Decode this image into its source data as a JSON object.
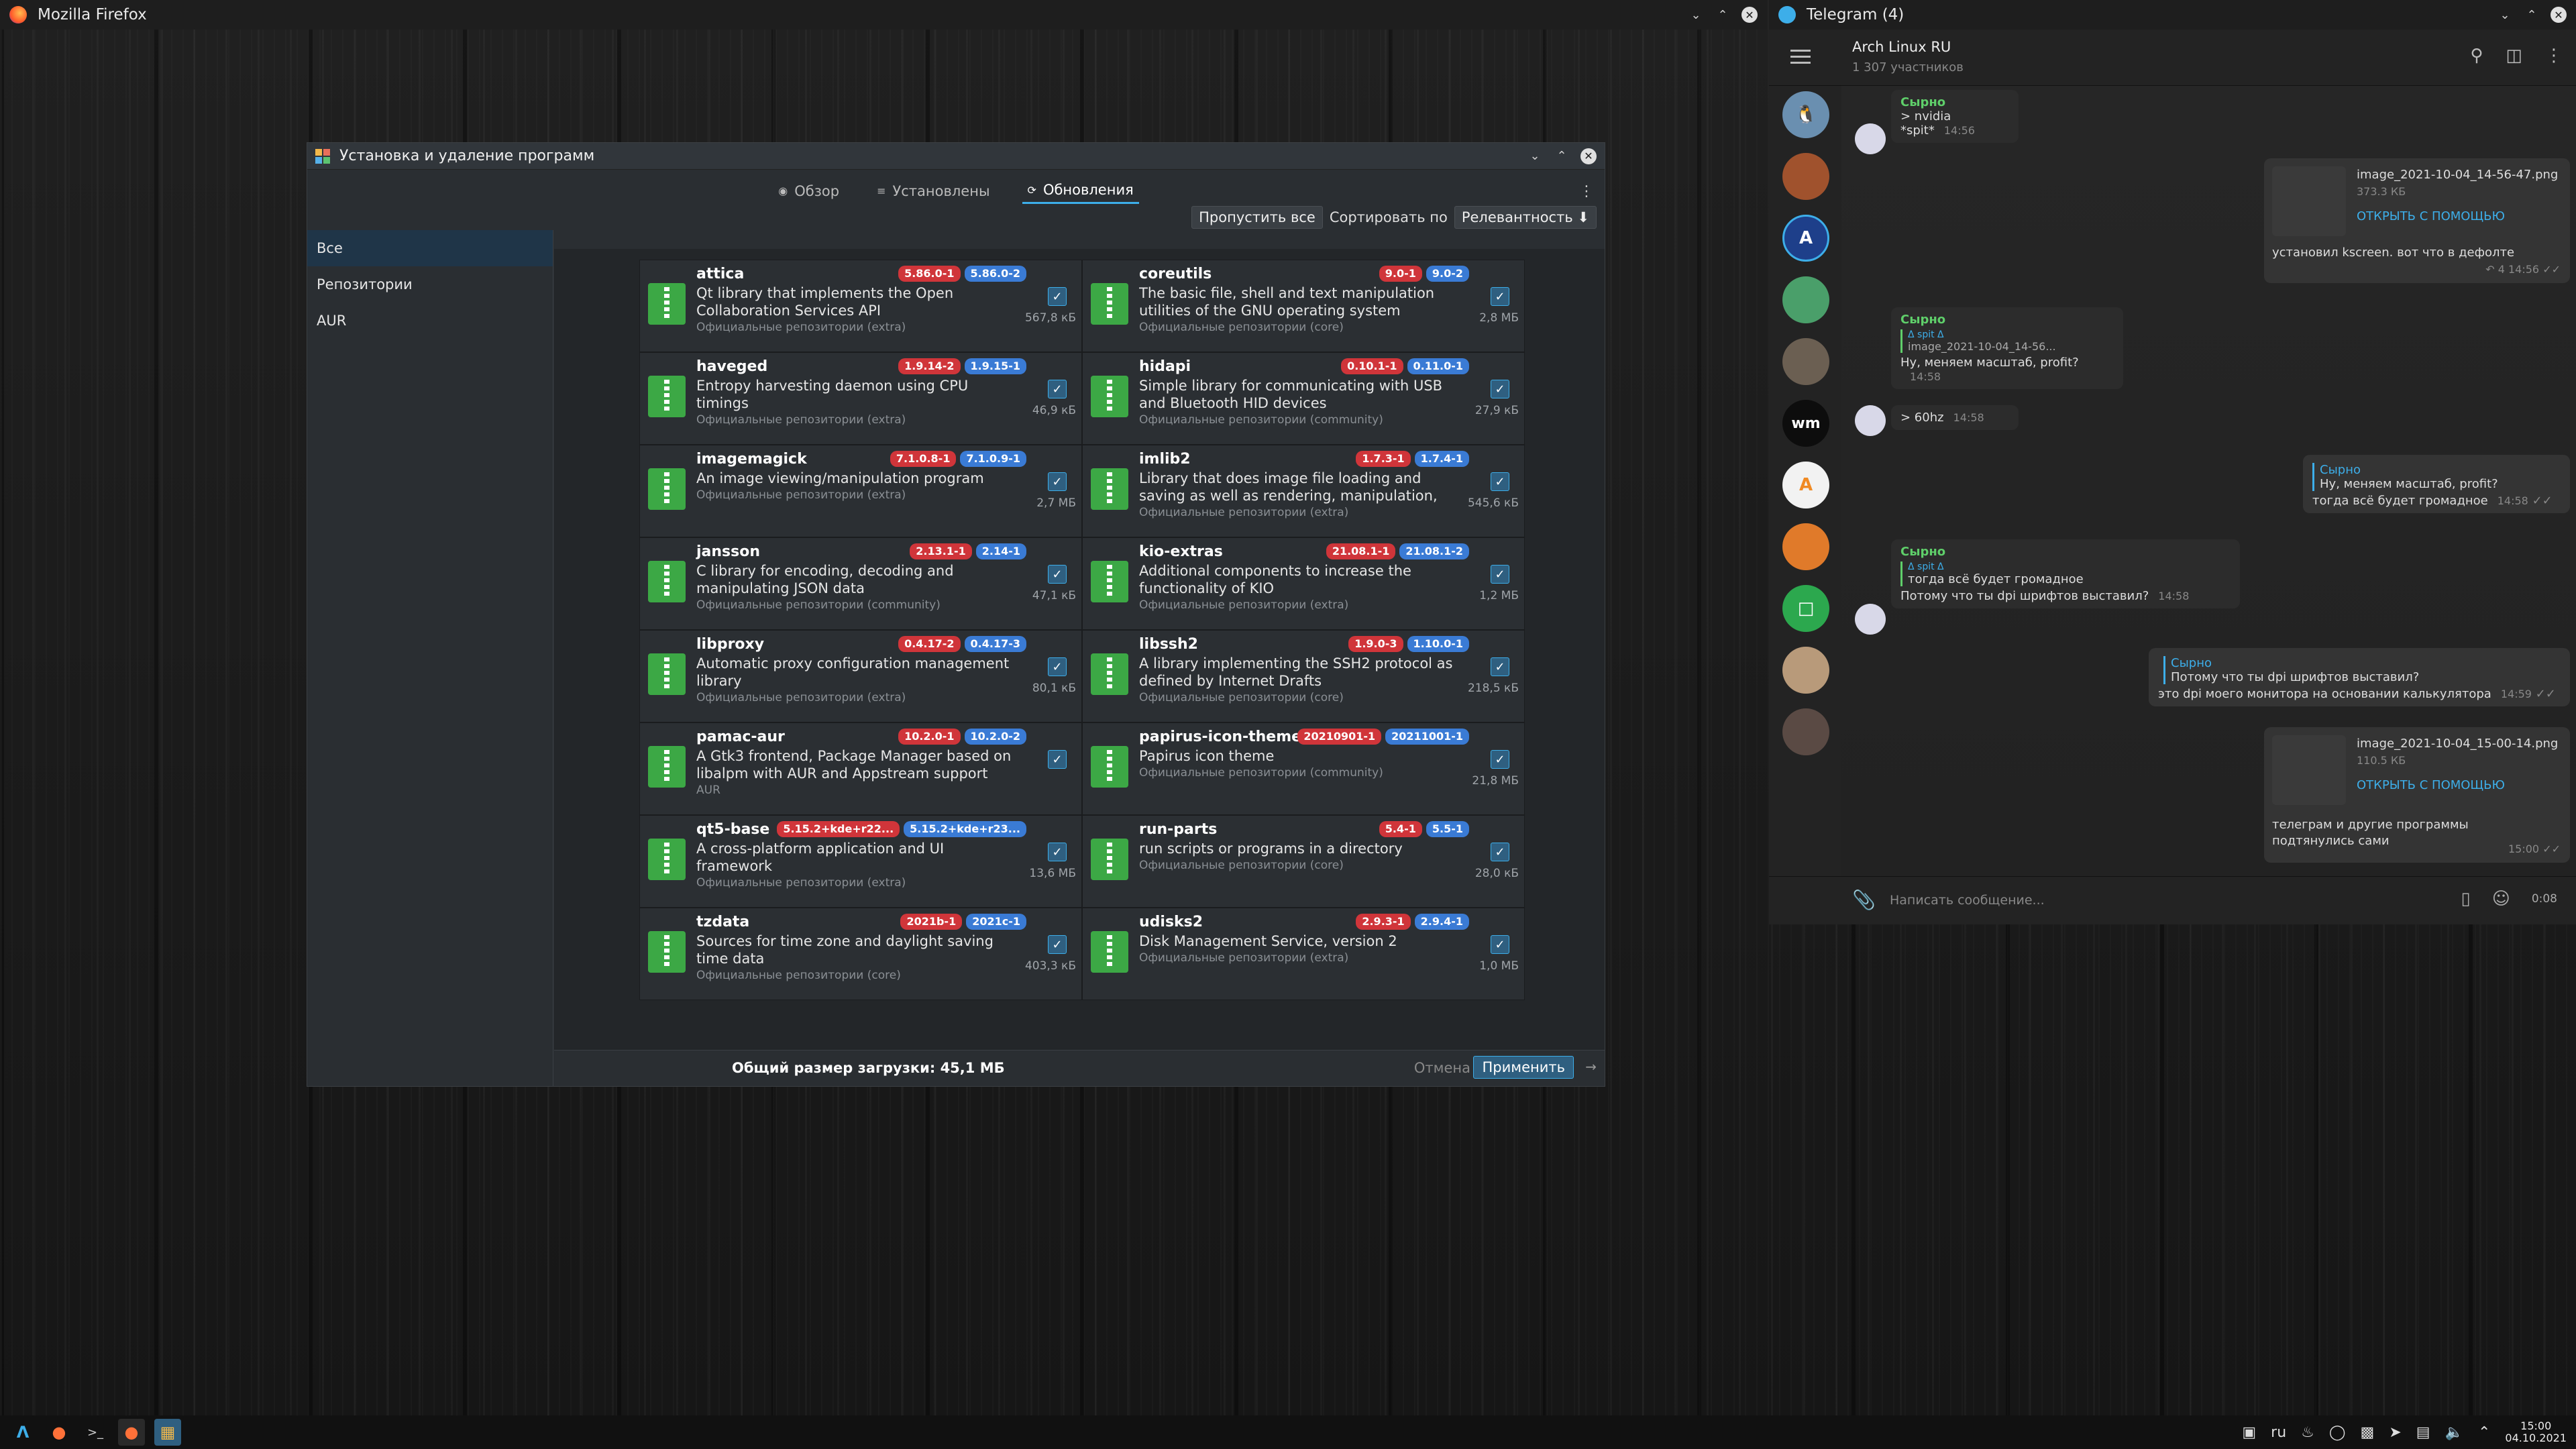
{
  "firefox": {
    "title": "Mozilla Firefox"
  },
  "pamac": {
    "title": "Установка и удаление программ",
    "tabs": [
      {
        "label": "Обзор",
        "icon": "globe-icon"
      },
      {
        "label": "Установлены",
        "icon": "list-icon"
      },
      {
        "label": "Обновления",
        "icon": "refresh-icon",
        "active": true
      }
    ],
    "toolbar": {
      "skip_all": "Пропустить все",
      "sort_by": "Сортировать по",
      "sort_value": "Релевантность",
      "sort_arrow": "⬇"
    },
    "sidebar": [
      "Все",
      "Репозитории",
      "AUR"
    ],
    "packages": [
      {
        "name": "attica",
        "old": "5.86.0-1",
        "new": "5.86.0-2",
        "desc": "Qt library that implements the Open Collaboration Services API",
        "repo": "Официальные репозитории (extra)",
        "size": "567,8 кБ"
      },
      {
        "name": "coreutils",
        "old": "9.0-1",
        "new": "9.0-2",
        "desc": "The basic file, shell and text manipulation utilities of the GNU operating system",
        "repo": "Официальные репозитории (core)",
        "size": "2,8 МБ"
      },
      {
        "name": "haveged",
        "old": "1.9.14-2",
        "new": "1.9.15-1",
        "desc": "Entropy harvesting daemon using CPU timings",
        "repo": "Официальные репозитории (extra)",
        "size": "46,9 кБ"
      },
      {
        "name": "hidapi",
        "old": "0.10.1-1",
        "new": "0.11.0-1",
        "desc": "Simple library for communicating with USB and Bluetooth HID devices",
        "repo": "Официальные репозитории (community)",
        "size": "27,9 кБ"
      },
      {
        "name": "imagemagick",
        "old": "7.1.0.8-1",
        "new": "7.1.0.9-1",
        "desc": "An image viewing/manipulation program",
        "repo": "Официальные репозитории (extra)",
        "size": "2,7 МБ"
      },
      {
        "name": "imlib2",
        "old": "1.7.3-1",
        "new": "1.7.4-1",
        "desc": "Library that does image file loading and saving as well as rendering, manipulation, arbitrary p…",
        "repo": "Официальные репозитории (extra)",
        "size": "545,6 кБ"
      },
      {
        "name": "jansson",
        "old": "2.13.1-1",
        "new": "2.14-1",
        "desc": "C library for encoding, decoding and manipulating JSON data",
        "repo": "Официальные репозитории (community)",
        "size": "47,1 кБ"
      },
      {
        "name": "kio-extras",
        "old": "21.08.1-1",
        "new": "21.08.1-2",
        "desc": "Additional components to increase the functionality of KIO",
        "repo": "Официальные репозитории (extra)",
        "size": "1,2 МБ"
      },
      {
        "name": "libproxy",
        "old": "0.4.17-2",
        "new": "0.4.17-3",
        "desc": "Automatic proxy configuration management library",
        "repo": "Официальные репозитории (extra)",
        "size": "80,1 кБ"
      },
      {
        "name": "libssh2",
        "old": "1.9.0-3",
        "new": "1.10.0-1",
        "desc": "A library implementing the SSH2 protocol as defined by Internet Drafts",
        "repo": "Официальные репозитории (core)",
        "size": "218,5 кБ"
      },
      {
        "name": "pamac-aur",
        "old": "10.2.0-1",
        "new": "10.2.0-2",
        "desc": "A Gtk3 frontend, Package Manager based on libalpm with AUR and Appstream support",
        "repo": "AUR",
        "size": ""
      },
      {
        "name": "papirus-icon-theme",
        "old": "20210901-1",
        "new": "20211001-1",
        "desc": "Papirus icon theme",
        "repo": "Официальные репозитории (community)",
        "size": "21,8 МБ"
      },
      {
        "name": "qt5-base",
        "old": "5.15.2+kde+r22...",
        "new": "5.15.2+kde+r23...",
        "desc": "A cross-platform application and UI framework",
        "repo": "Официальные репозитории (extra)",
        "size": "13,6 МБ"
      },
      {
        "name": "run-parts",
        "old": "5.4-1",
        "new": "5.5-1",
        "desc": "run scripts or programs in a directory",
        "repo": "Официальные репозитории (core)",
        "size": "28,0 кБ"
      },
      {
        "name": "tzdata",
        "old": "2021b-1",
        "new": "2021c-1",
        "desc": "Sources for time zone and daylight saving time data",
        "repo": "Официальные репозитории (core)",
        "size": "403,3 кБ"
      },
      {
        "name": "udisks2",
        "old": "2.9.3-1",
        "new": "2.9.4-1",
        "desc": "Disk Management Service, version 2",
        "repo": "Официальные репозитории (extra)",
        "size": "1,0 МБ"
      }
    ],
    "footer": {
      "total": "Общий размер загрузки: 45,1 МБ",
      "cancel": "Отмена",
      "apply": "Применить"
    }
  },
  "telegram": {
    "title": "Telegram (4)",
    "chat_name": "Arch Linux RU",
    "members": "1 307 участников",
    "input_placeholder": "Написать сообщение...",
    "voice_time": "0:08",
    "messages": {
      "m1": {
        "from": "Сырно",
        "l1": "> nvidia",
        "l2": "*spit*",
        "time": "14:56"
      },
      "m2": {
        "file": "image_2021-10-04_14-56-47.png",
        "size": "373.3 КБ",
        "link": "ОТКРЫТЬ С ПОМОЩЬЮ",
        "caption": "установил kscreen. вот что в дефолте",
        "replies": "4",
        "time": "14:56"
      },
      "m3": {
        "from": "Сырно",
        "qfrom": "Δ spit Δ",
        "qtext": "image_2021-10-04_14-56...",
        "text": "Ну, меняем масштаб, profit?",
        "time": "14:58"
      },
      "m4": {
        "text": "> 60hz",
        "time": "14:58"
      },
      "m5": {
        "qfrom": "Сырно",
        "qtext": "Ну, меняем масштаб, profit?",
        "text": "тогда всё будет громадное",
        "time": "14:58"
      },
      "m6": {
        "from": "Сырно",
        "qfrom": "Δ spit Δ",
        "qtext": "тогда всё будет громадное",
        "text": "Потому что ты dpi шрифтов выставил?",
        "time": "14:58"
      },
      "m7": {
        "qfrom": "Сырно",
        "qtext": "Потому что ты dpi шрифтов выставил?",
        "text": "это dpi моего монитора на основании калькулятора",
        "time": "14:59"
      },
      "m8": {
        "file": "image_2021-10-04_15-00-14.png",
        "size": "110.5 КБ",
        "link": "ОТКРЫТЬ С ПОМОЩЬЮ",
        "caption": "телеграм и другие программы подтянулись сами",
        "time": "15:00"
      }
    }
  },
  "taskbar": {
    "lang": "ru",
    "time": "15:00",
    "date": "04.10.2021"
  },
  "colors": {
    "accent": "#3daee9",
    "old_version": "#d0353a",
    "new_version": "#3a7bd5",
    "tg_green": "#5fcf6a"
  }
}
